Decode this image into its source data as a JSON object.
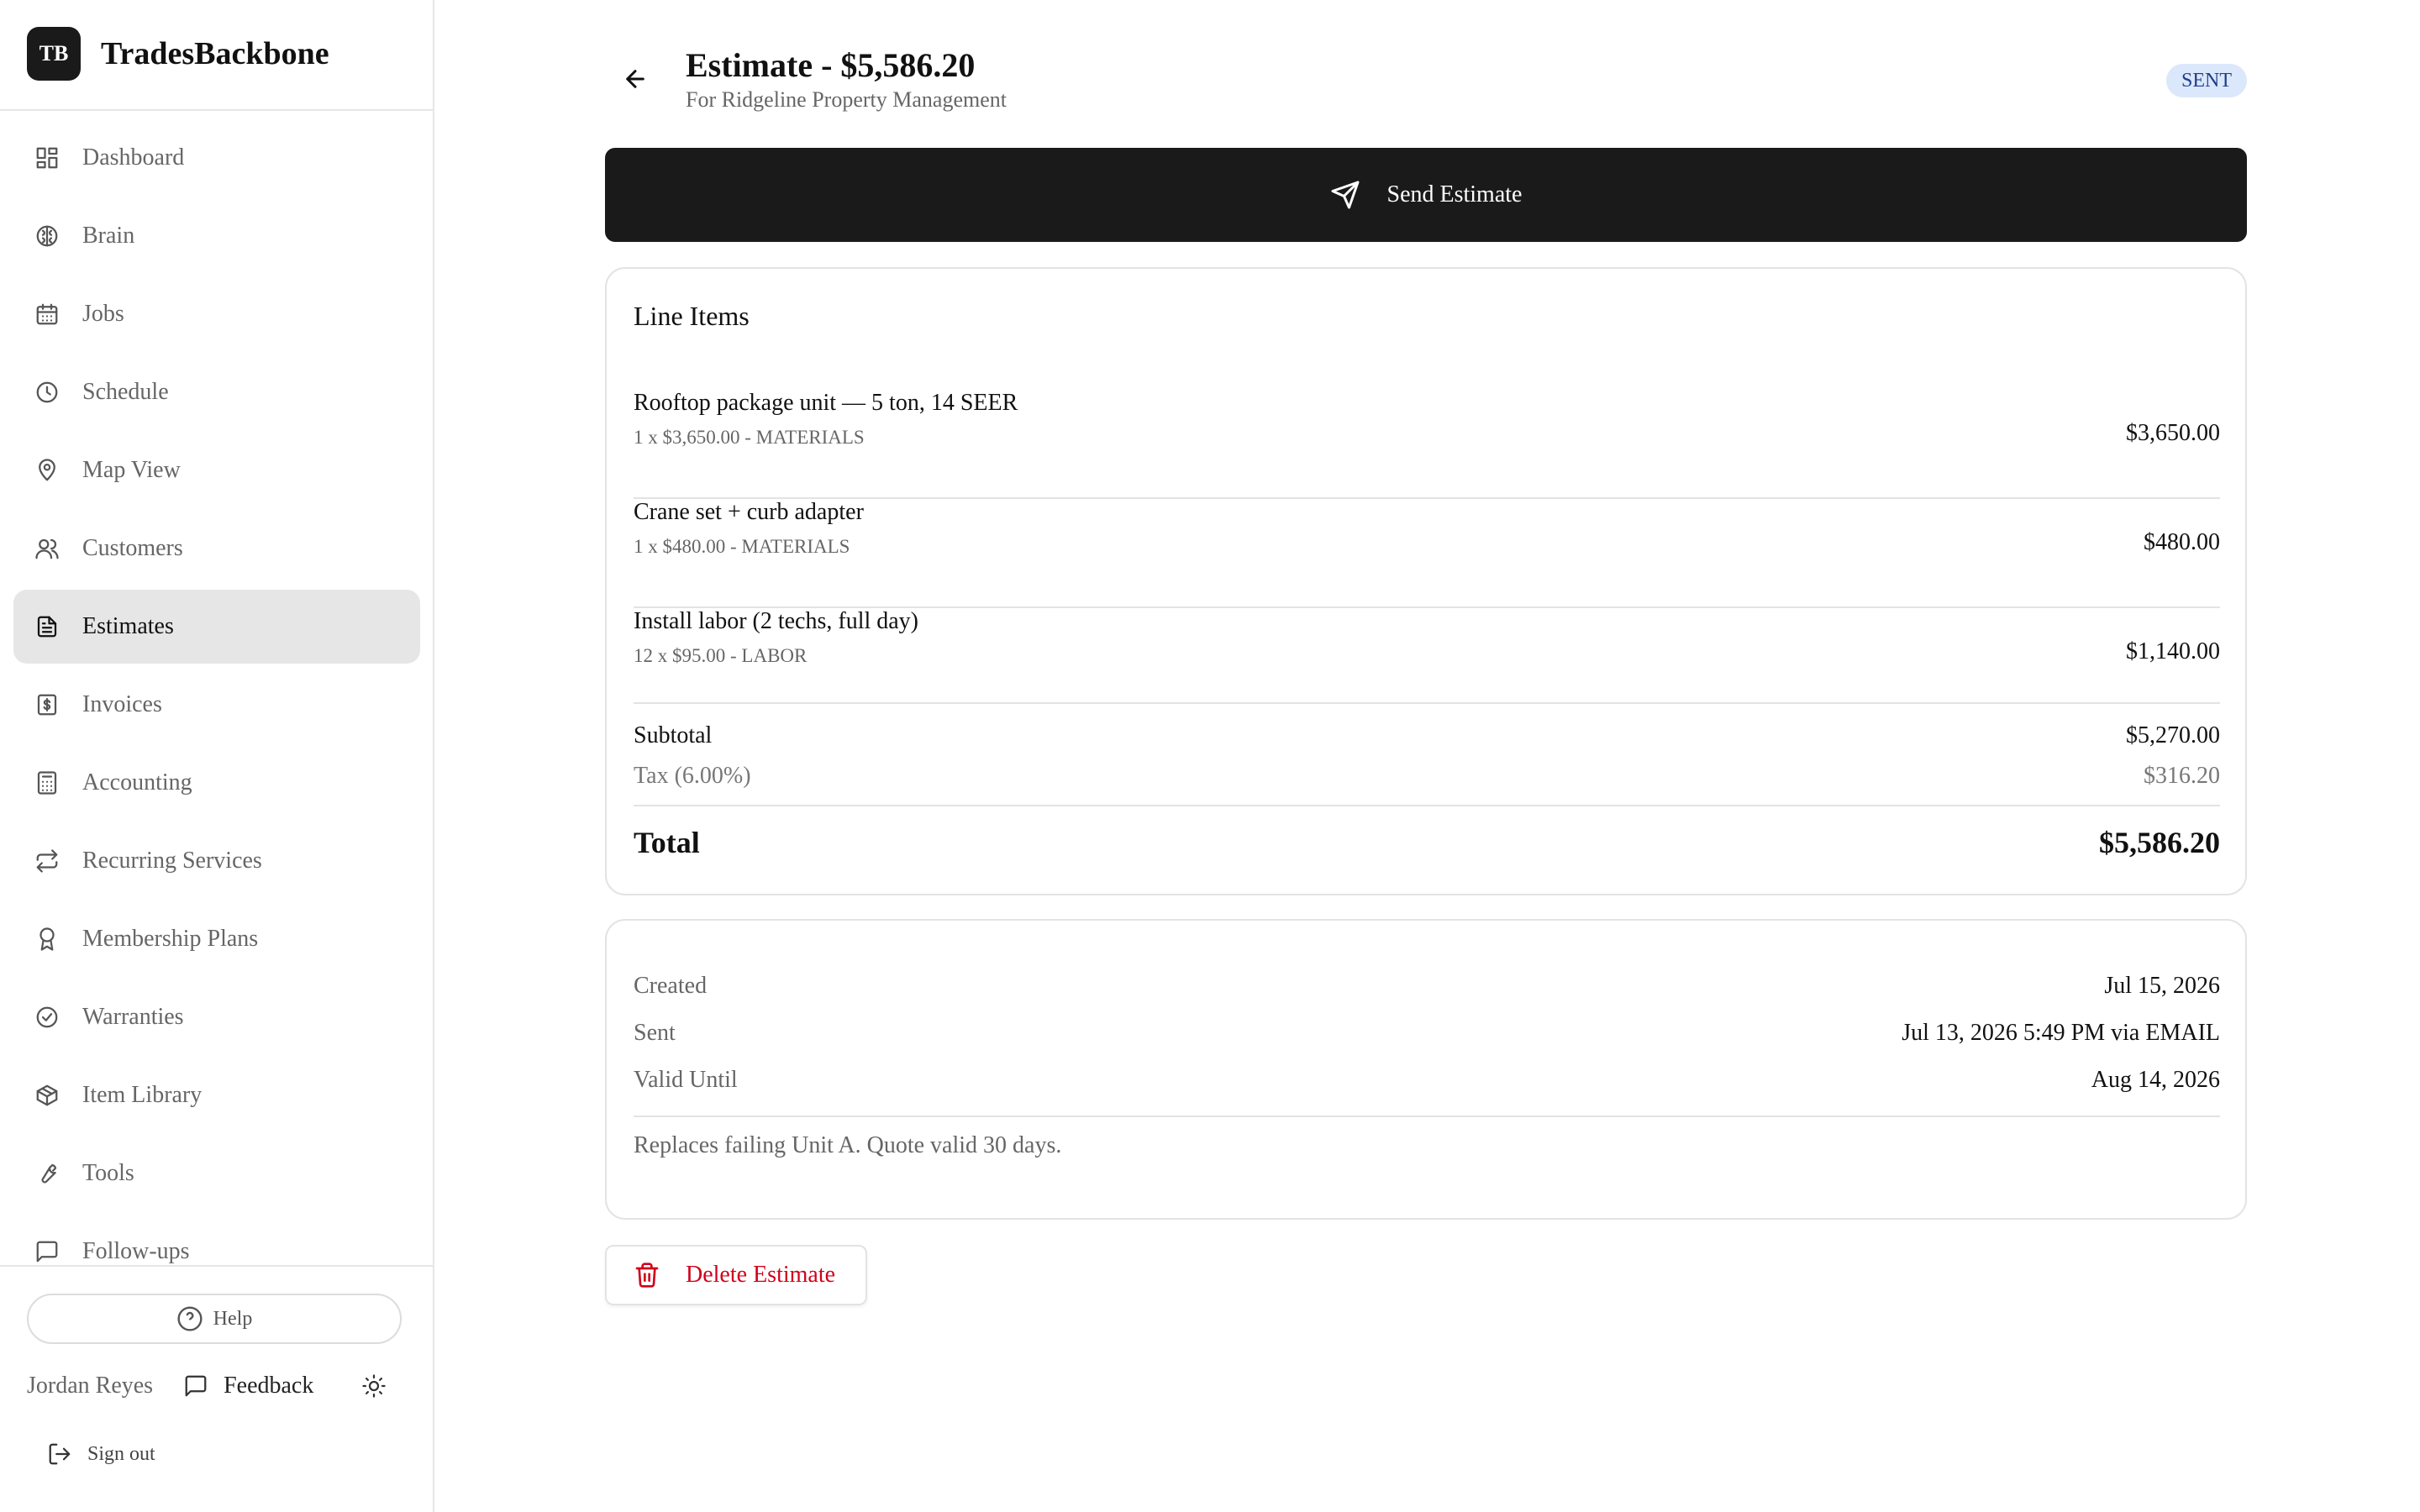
{
  "brand": {
    "logo_text": "TB",
    "name": "TradesBackbone"
  },
  "sidebar": {
    "items": [
      {
        "label": "Dashboard",
        "icon": "grid-icon",
        "active": false
      },
      {
        "label": "Brain",
        "icon": "brain-icon",
        "active": false
      },
      {
        "label": "Jobs",
        "icon": "calendar-icon",
        "active": false
      },
      {
        "label": "Schedule",
        "icon": "clock-icon",
        "active": false
      },
      {
        "label": "Map View",
        "icon": "map-pin-icon",
        "active": false
      },
      {
        "label": "Customers",
        "icon": "users-icon",
        "active": false
      },
      {
        "label": "Estimates",
        "icon": "file-text-icon",
        "active": true
      },
      {
        "label": "Invoices",
        "icon": "receipt-icon",
        "active": false
      },
      {
        "label": "Accounting",
        "icon": "calculator-icon",
        "active": false
      },
      {
        "label": "Recurring Services",
        "icon": "repeat-icon",
        "active": false
      },
      {
        "label": "Membership Plans",
        "icon": "award-icon",
        "active": false
      },
      {
        "label": "Warranties",
        "icon": "check-circle-icon",
        "active": false
      },
      {
        "label": "Item Library",
        "icon": "package-icon",
        "active": false
      },
      {
        "label": "Tools",
        "icon": "wrench-icon",
        "active": false
      },
      {
        "label": "Follow-ups",
        "icon": "message-square-icon",
        "active": false
      }
    ],
    "help_label": "Help",
    "user_name": "Jordan Reyes",
    "feedback_label": "Feedback",
    "signout_label": "Sign out"
  },
  "header": {
    "title": "Estimate - $5,586.20",
    "subtitle": "For Ridgeline Property Management",
    "status": "SENT"
  },
  "send_button_label": "Send Estimate",
  "line_items": {
    "title": "Line Items",
    "items": [
      {
        "name": "Rooftop package unit — 5 ton, 14 SEER",
        "detail": "1 x $3,650.00 - MATERIALS",
        "amount": "$3,650.00"
      },
      {
        "name": "Crane set + curb adapter",
        "detail": "1 x $480.00 - MATERIALS",
        "amount": "$480.00"
      },
      {
        "name": "Install labor (2 techs, full day)",
        "detail": "12 x $95.00 - LABOR",
        "amount": "$1,140.00"
      }
    ],
    "subtotal_label": "Subtotal",
    "subtotal": "$5,270.00",
    "tax_label": "Tax (6.00%)",
    "tax": "$316.20",
    "total_label": "Total",
    "total": "$5,586.20"
  },
  "meta": {
    "created_label": "Created",
    "created": "Jul 15, 2026",
    "sent_label": "Sent",
    "sent": "Jul 13, 2026 5:49 PM via EMAIL",
    "valid_label": "Valid Until",
    "valid": "Aug 14, 2026",
    "notes": "Replaces failing Unit A. Quote valid 30 days."
  },
  "delete_button_label": "Delete Estimate",
  "colors": {
    "primary_button": "#1a1a1a",
    "status_badge_bg": "#dbe7fb",
    "status_badge_text": "#1e3f8a",
    "danger": "#d0021b",
    "active_nav_bg": "#e6e6e6"
  }
}
